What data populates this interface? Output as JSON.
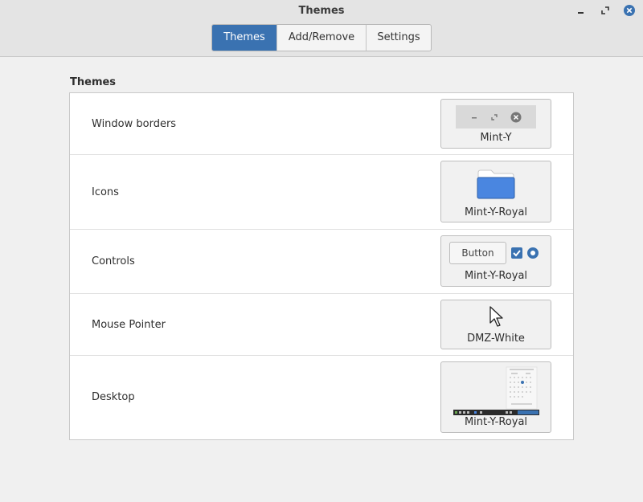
{
  "window": {
    "title": "Themes"
  },
  "tabs": [
    {
      "label": "Themes",
      "active": true
    },
    {
      "label": "Add/Remove",
      "active": false
    },
    {
      "label": "Settings",
      "active": false
    }
  ],
  "section": {
    "title": "Themes"
  },
  "rows": [
    {
      "label": "Window borders",
      "theme": "Mint-Y"
    },
    {
      "label": "Icons",
      "theme": "Mint-Y-Royal"
    },
    {
      "label": "Controls",
      "theme": "Mint-Y-Royal",
      "button_label": "Button"
    },
    {
      "label": "Mouse Pointer",
      "theme": "DMZ-White"
    },
    {
      "label": "Desktop",
      "theme": "Mint-Y-Royal"
    }
  ],
  "colors": {
    "accent": "#3a72b1",
    "folder": "#4a86e0",
    "header_bg": "#e4e4e4"
  }
}
